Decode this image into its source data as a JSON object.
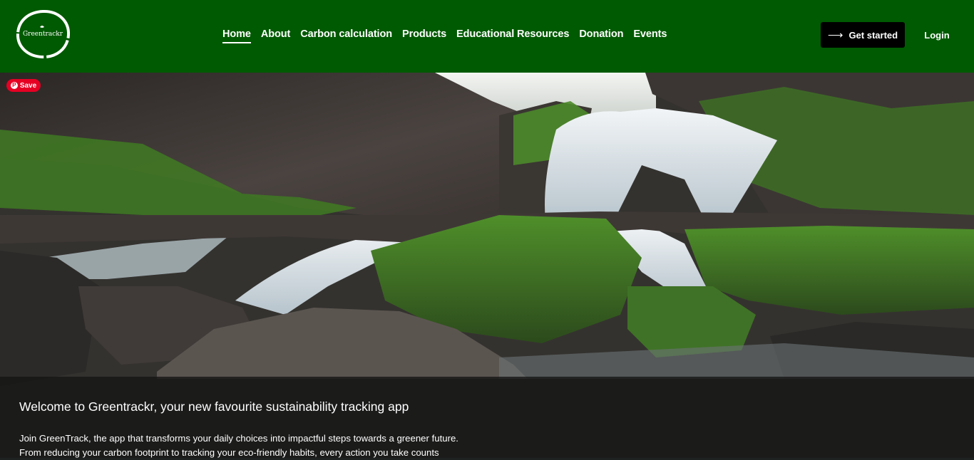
{
  "logo": {
    "text": "Greentrackr",
    "icon": "leaf-circle-logo"
  },
  "nav": {
    "items": [
      {
        "label": "Home",
        "active": true
      },
      {
        "label": "About"
      },
      {
        "label": "Carbon calculation"
      },
      {
        "label": "Products"
      },
      {
        "label": "Educational Resources"
      },
      {
        "label": "Donation"
      },
      {
        "label": "Events"
      }
    ]
  },
  "actions": {
    "get_started_label": "Get started",
    "get_started_icon": "arrow-right-icon",
    "login_label": "Login"
  },
  "pin_save": {
    "label": "Save",
    "icon": "pinterest-icon"
  },
  "hero": {
    "image": "waterfall-over-mossy-rocks",
    "headline": "Welcome to Greentrackr, your new favourite sustainability tracking app",
    "description_line1": "Join GreenTrack, the app that transforms your daily choices into impactful steps towards a greener future.",
    "description_line2": "From reducing your carbon footprint to tracking your eco-friendly habits, every action you take counts"
  },
  "colors": {
    "header_bg": "#005a02",
    "button_bg": "#000000",
    "pin_red": "#e60023"
  }
}
